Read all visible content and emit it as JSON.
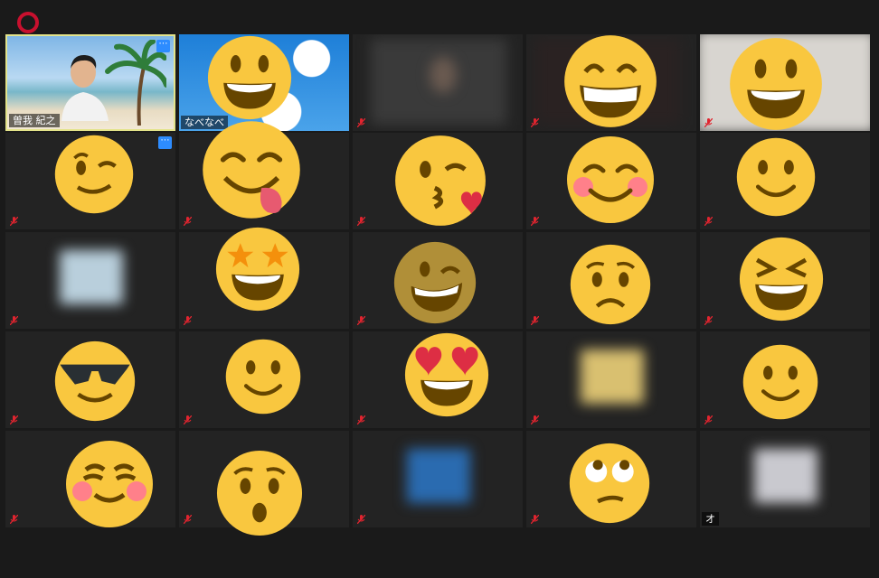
{
  "recording": {
    "icon": "record-ring-icon",
    "color": "#c8102e"
  },
  "tiles": [
    {
      "id": "t1",
      "name": "曽我 紀之",
      "active": true,
      "video": "beach",
      "more": true
    },
    {
      "id": "t2",
      "name": "なべなべ",
      "video": "sky"
    },
    {
      "id": "t3",
      "name": "",
      "video": "blur-dark"
    },
    {
      "id": "t4",
      "name": "",
      "video": "blur-dark2"
    },
    {
      "id": "t5",
      "name": "",
      "video": "blur-light"
    },
    {
      "id": "t6",
      "name": "",
      "more": true
    },
    {
      "id": "t7",
      "name": ""
    },
    {
      "id": "t8",
      "name": ""
    },
    {
      "id": "t9",
      "name": ""
    },
    {
      "id": "t10",
      "name": ""
    },
    {
      "id": "t11",
      "name": "",
      "video": "blur-thumb"
    },
    {
      "id": "t12",
      "name": ""
    },
    {
      "id": "t13",
      "name": ""
    },
    {
      "id": "t14",
      "name": ""
    },
    {
      "id": "t15",
      "name": ""
    },
    {
      "id": "t16",
      "name": ""
    },
    {
      "id": "t17",
      "name": ""
    },
    {
      "id": "t18",
      "name": ""
    },
    {
      "id": "t19",
      "name": "",
      "video": "blur-yellow"
    },
    {
      "id": "t20",
      "name": ""
    },
    {
      "id": "t21",
      "name": ""
    },
    {
      "id": "t22",
      "name": ""
    },
    {
      "id": "t23",
      "name": "",
      "video": "blur-blue"
    },
    {
      "id": "t24",
      "name": ""
    },
    {
      "id": "t25",
      "name": "オ",
      "video": "blur-light2"
    }
  ],
  "reactions": [
    "grinning-face-icon",
    "beaming-face-icon",
    "smiling-big-eyes-icon",
    "winking-face-icon",
    "face-savoring-food-icon",
    "face-blowing-kiss-icon",
    "smiling-face-blush-icon",
    "slightly-smiling-face-icon",
    "star-struck-icon",
    "grinning-squinting-icon",
    "worried-face-icon",
    "laughing-squinting-icon",
    "sunglasses-face-icon",
    "slightly-smiling-face-icon",
    "heart-eyes-icon",
    "slightly-smiling-face-icon",
    "smiling-face-icon",
    "hushed-face-icon",
    "face-rolling-eyes-icon"
  ],
  "colors": {
    "emoji_yellow": "#f9c73f",
    "emoji_dark": "#664500",
    "tile_bg": "#232323",
    "active_border": "#e3e38a",
    "mute_red": "#e0242f",
    "more_blue": "#2d8cff"
  }
}
